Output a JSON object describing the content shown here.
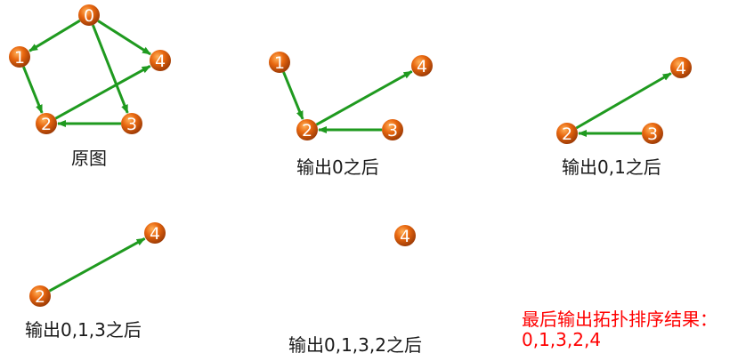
{
  "colors": {
    "node_fill": "#e06010",
    "edge": "#1f9a1f",
    "caption": "#1a1a1a",
    "result": "#ff0000"
  },
  "panels": [
    {
      "caption": "原图",
      "nodes": [
        {
          "id": "0"
        },
        {
          "id": "1"
        },
        {
          "id": "2"
        },
        {
          "id": "3"
        },
        {
          "id": "4"
        }
      ],
      "edges": [
        [
          "0",
          "1"
        ],
        [
          "0",
          "3"
        ],
        [
          "0",
          "4"
        ],
        [
          "1",
          "2"
        ],
        [
          "2",
          "4"
        ],
        [
          "3",
          "2"
        ]
      ]
    },
    {
      "caption": "输出0之后",
      "nodes": [
        {
          "id": "1"
        },
        {
          "id": "2"
        },
        {
          "id": "3"
        },
        {
          "id": "4"
        }
      ],
      "edges": [
        [
          "1",
          "2"
        ],
        [
          "2",
          "4"
        ],
        [
          "3",
          "2"
        ]
      ]
    },
    {
      "caption": "输出0,1之后",
      "nodes": [
        {
          "id": "2"
        },
        {
          "id": "3"
        },
        {
          "id": "4"
        }
      ],
      "edges": [
        [
          "2",
          "4"
        ],
        [
          "3",
          "2"
        ]
      ]
    },
    {
      "caption": "输出0,1,3之后",
      "nodes": [
        {
          "id": "2"
        },
        {
          "id": "4"
        }
      ],
      "edges": [
        [
          "2",
          "4"
        ]
      ]
    },
    {
      "caption": "输出0,1,3,2之后",
      "nodes": [
        {
          "id": "4"
        }
      ],
      "edges": []
    }
  ],
  "result": {
    "title": "最后输出拓扑排序结果：",
    "value": "0,1,3,2,4"
  }
}
